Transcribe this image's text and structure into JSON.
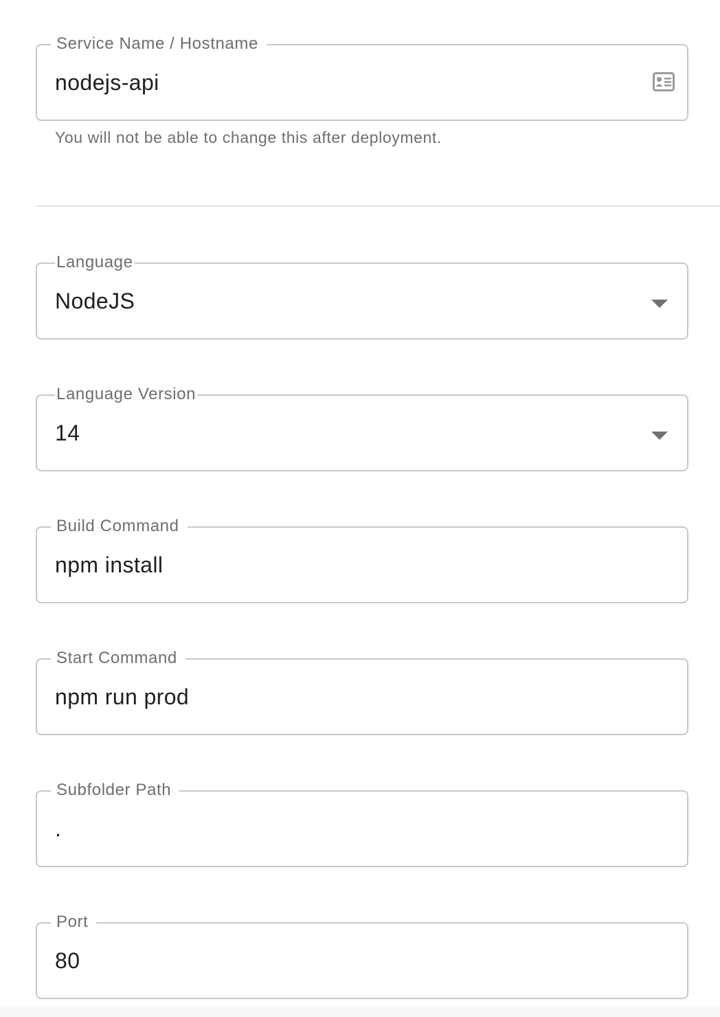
{
  "service_name": {
    "label": "Service Name / Hostname",
    "value": "nodejs-api",
    "helper_text": "You will not be able to change this after deployment.",
    "icon": "contact-card-icon"
  },
  "language": {
    "label": "Language",
    "value": "NodeJS",
    "icon": "dropdown-arrow-icon"
  },
  "language_version": {
    "label": "Language Version",
    "value": "14",
    "icon": "dropdown-arrow-icon"
  },
  "build_command": {
    "label": "Build Command",
    "value": "npm install"
  },
  "start_command": {
    "label": "Start Command",
    "value": "npm run prod"
  },
  "subfolder_path": {
    "label": "Subfolder Path",
    "value": "."
  },
  "port": {
    "label": "Port",
    "value": "80"
  },
  "colors": {
    "border": "#c8c8c8",
    "label": "#6e6e6e",
    "text": "#1f1f1f",
    "divider": "#e4e4e4"
  }
}
